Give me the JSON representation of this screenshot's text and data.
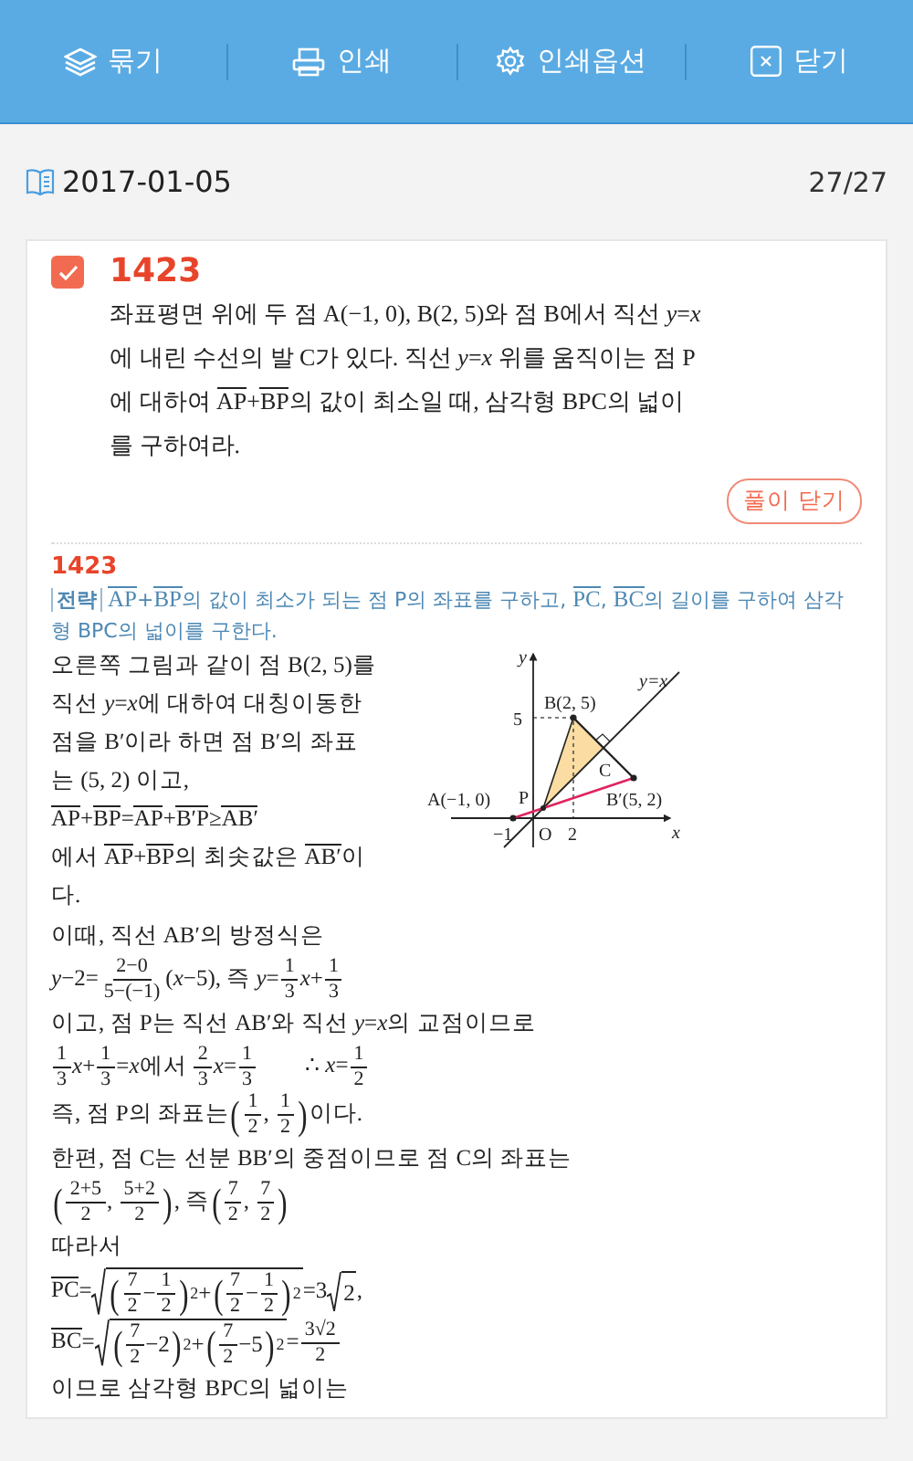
{
  "toolbar": {
    "buttons": [
      {
        "kind": "layers",
        "label": "묶기"
      },
      {
        "kind": "printer",
        "label": "인쇄"
      },
      {
        "kind": "gear",
        "label": "인쇄옵션"
      },
      {
        "kind": "close",
        "label": "닫기"
      }
    ]
  },
  "date_bar": {
    "date": "2017-01-05",
    "counter": "27/27"
  },
  "problem": {
    "checked": true,
    "number": "1423",
    "parts": [
      {
        "kind": "t",
        "text": "좌표평면 위에 두 점 A(−1, 0), B(2, 5)와 점 B에서 직선 *y*=*x*"
      },
      {
        "kind": "t",
        "text": "에 내린 수선의 발 C가 있다. 직선 *y*=*x* 위를 움직이는 점 P에 대하여 "
      },
      {
        "kind": "ov",
        "text": "AP"
      },
      {
        "kind": "t",
        "text": "+"
      },
      {
        "kind": "ov",
        "text": "BP"
      },
      {
        "kind": "t",
        "text": "의 값이 최소일 때, 삼각형 BPC의 넓이를 구하여라."
      }
    ]
  },
  "toggle_button": "풀이 닫기",
  "solution": {
    "number": "1423",
    "strategy": {
      "tag": "전략",
      "parts": [
        {
          "kind": "ov",
          "text": "AP"
        },
        {
          "kind": "t",
          "text": "+"
        },
        {
          "kind": "ov",
          "text": "BP"
        },
        {
          "kind": "t",
          "text": "의 값이 최소가 되는 점 P의 좌표를 구하고, "
        },
        {
          "kind": "ov",
          "text": "PC"
        },
        {
          "kind": "t",
          "text": ", "
        },
        {
          "kind": "ov",
          "text": "BC"
        },
        {
          "kind": "t",
          "text": "의 길이를 구하여 삼각형 BPC의 넓이를 구한다."
        }
      ]
    },
    "figure_paragraphs": [
      [
        {
          "kind": "t",
          "text": "오른쪽 그림과 같이 점 B(2, 5)를 직선 *y*=*x*"
        },
        {
          "kind": "t",
          "text": "에 대하여 대칭이동한 점을 B′이라 하면 점 B′의 좌표는 (5, 2) 이고,"
        }
      ],
      [
        {
          "kind": "ov",
          "text": "AP"
        },
        {
          "kind": "t",
          "text": "+"
        },
        {
          "kind": "ov",
          "text": "BP"
        },
        {
          "kind": "t",
          "text": "="
        },
        {
          "kind": "ov",
          "text": "AP"
        },
        {
          "kind": "t",
          "text": "+"
        },
        {
          "kind": "ov",
          "text": "B′P"
        },
        {
          "kind": "t",
          "text": "≥"
        },
        {
          "kind": "ov",
          "text": "AB′"
        }
      ],
      [
        {
          "kind": "t",
          "text": "에서 "
        },
        {
          "kind": "ov",
          "text": "AP"
        },
        {
          "kind": "t",
          "text": "+"
        },
        {
          "kind": "ov",
          "text": "BP"
        },
        {
          "kind": "t",
          "text": "의 최솟값은 "
        },
        {
          "kind": "ov",
          "text": "AB′"
        },
        {
          "kind": "t",
          "text": "이다."
        }
      ]
    ],
    "figure": {
      "labels": [
        "y",
        "y=x",
        "B(2, 5)",
        "5",
        "C",
        "A(−1, 0)",
        "P",
        "B′(5, 2)",
        "−1",
        "O",
        "2",
        "x"
      ]
    },
    "lines": [
      [
        {
          "kind": "t",
          "text": "이때, 직선 AB′의 방정식은"
        }
      ],
      [
        {
          "kind": "t",
          "text": "*y*−2="
        },
        {
          "kind": "frac",
          "num": "2−0",
          "den": "5−(−1)"
        },
        {
          "kind": "t",
          "text": "(*x*−5), 즉 *y*="
        },
        {
          "kind": "frac",
          "num": "1",
          "den": "3"
        },
        {
          "kind": "t",
          "text": "*x*+"
        },
        {
          "kind": "frac",
          "num": "1",
          "den": "3"
        }
      ],
      [
        {
          "kind": "t",
          "text": "이고, 점 P는 직선 AB′와 직선 *y*=*x*"
        },
        {
          "kind": "t",
          "text": "의 교점이므로"
        }
      ],
      [
        {
          "kind": "frac",
          "num": "1",
          "den": "3"
        },
        {
          "kind": "t",
          "text": "*x*+"
        },
        {
          "kind": "frac",
          "num": "1",
          "den": "3"
        },
        {
          "kind": "t",
          "text": "=*x*"
        },
        {
          "kind": "t",
          "text": "에서 "
        },
        {
          "kind": "frac",
          "num": "2",
          "den": "3"
        },
        {
          "kind": "t",
          "text": "*x*="
        },
        {
          "kind": "frac",
          "num": "1",
          "den": "3"
        },
        {
          "kind": "therefore",
          "text": "∴ *x*="
        },
        {
          "kind": "frac",
          "num": "1",
          "den": "2"
        }
      ],
      [
        {
          "kind": "t",
          "text": "즉, 점 P의 좌표는"
        },
        {
          "kind": "big",
          "text": "("
        },
        {
          "kind": "frac",
          "num": "1",
          "den": "2"
        },
        {
          "kind": "t",
          "text": ", "
        },
        {
          "kind": "frac",
          "num": "1",
          "den": "2"
        },
        {
          "kind": "big",
          "text": ")"
        },
        {
          "kind": "t",
          "text": "이다."
        }
      ],
      [
        {
          "kind": "t",
          "text": "한편, 점 C는 선분 BB′의 중점이므로 점 C의 좌표는"
        }
      ],
      [
        {
          "kind": "big",
          "text": "("
        },
        {
          "kind": "frac",
          "num": "2+5",
          "den": "2"
        },
        {
          "kind": "t",
          "text": ", "
        },
        {
          "kind": "frac",
          "num": "5+2",
          "den": "2"
        },
        {
          "kind": "big",
          "text": ")"
        },
        {
          "kind": "t",
          "text": ", 즉"
        },
        {
          "kind": "big",
          "text": "("
        },
        {
          "kind": "frac",
          "num": "7",
          "den": "2"
        },
        {
          "kind": "t",
          "text": ", "
        },
        {
          "kind": "frac",
          "num": "7",
          "den": "2"
        },
        {
          "kind": "big",
          "text": ")"
        }
      ],
      [
        {
          "kind": "t",
          "text": "따라서"
        }
      ],
      [
        {
          "kind": "ov",
          "text": "PC"
        },
        {
          "kind": "t",
          "text": "="
        },
        {
          "kind": "sqrt",
          "parts": [
            {
              "kind": "big",
              "text": "("
            },
            {
              "kind": "frac",
              "num": "7",
              "den": "2"
            },
            {
              "kind": "t",
              "text": "−"
            },
            {
              "kind": "frac",
              "num": "1",
              "den": "2"
            },
            {
              "kind": "big",
              "text": ")"
            },
            {
              "kind": "sup",
              "text": "2"
            },
            {
              "kind": "t",
              "text": "+"
            },
            {
              "kind": "big",
              "text": "("
            },
            {
              "kind": "frac",
              "num": "7",
              "den": "2"
            },
            {
              "kind": "t",
              "text": "−"
            },
            {
              "kind": "frac",
              "num": "1",
              "den": "2"
            },
            {
              "kind": "big",
              "text": ")"
            },
            {
              "kind": "sup",
              "text": "2"
            }
          ]
        },
        {
          "kind": "t",
          "text": "=3"
        },
        {
          "kind": "sqrt",
          "parts": [
            {
              "kind": "t",
              "text": "2"
            }
          ]
        },
        {
          "kind": "t",
          "text": ","
        }
      ],
      [
        {
          "kind": "ov",
          "text": "BC"
        },
        {
          "kind": "t",
          "text": "="
        },
        {
          "kind": "sqrt",
          "parts": [
            {
              "kind": "big",
              "text": "("
            },
            {
              "kind": "frac",
              "num": "7",
              "den": "2"
            },
            {
              "kind": "t",
              "text": "−2"
            },
            {
              "kind": "big",
              "text": ")"
            },
            {
              "kind": "sup",
              "text": "2"
            },
            {
              "kind": "t",
              "text": "+"
            },
            {
              "kind": "big",
              "text": "("
            },
            {
              "kind": "frac",
              "num": "7",
              "den": "2"
            },
            {
              "kind": "t",
              "text": "−5"
            },
            {
              "kind": "big",
              "text": ")"
            },
            {
              "kind": "sup",
              "text": "2"
            }
          ]
        },
        {
          "kind": "t",
          "text": "="
        },
        {
          "kind": "frac",
          "num": "3√2",
          "den": "2"
        }
      ],
      [
        {
          "kind": "t",
          "text": "이므로 삼각형 BPC의 넓이는"
        }
      ]
    ]
  }
}
